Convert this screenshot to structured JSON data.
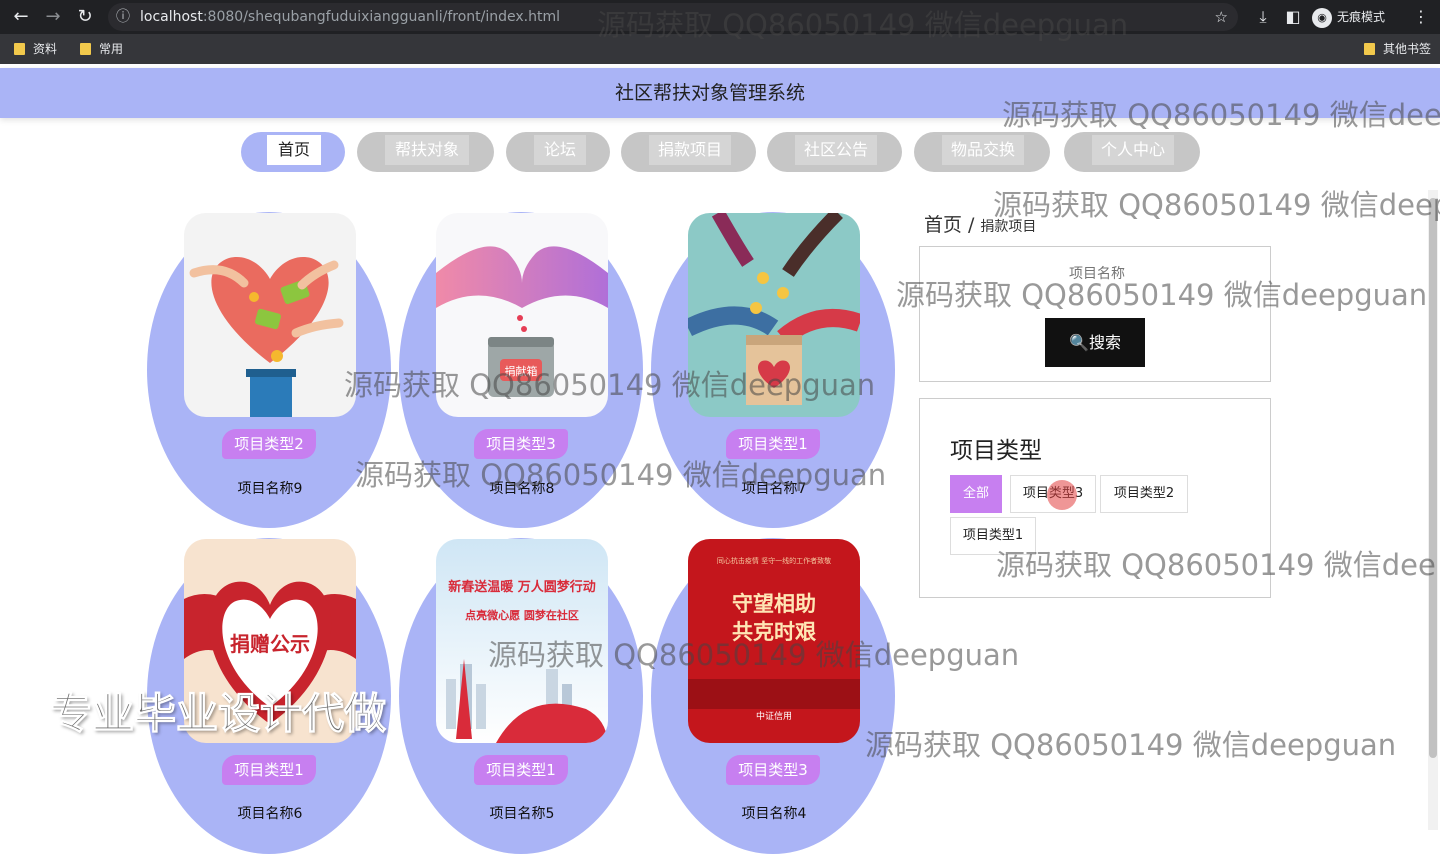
{
  "browser": {
    "url_host": "localhost",
    "url_path": ":8080/shequbangfuduixiangguanli/front/index.html",
    "incognito_label": "无痕模式",
    "bookmarks": [
      "资料",
      "常用"
    ],
    "other_bookmarks": "其他书签"
  },
  "site": {
    "title": "社区帮扶对象管理系统",
    "nav": [
      "首页",
      "帮扶对象",
      "论坛",
      "捐款项目",
      "社区公告",
      "物品交换",
      "个人中心"
    ]
  },
  "projects": [
    {
      "type": "项目类型2",
      "name": "项目名称9"
    },
    {
      "type": "项目类型3",
      "name": "项目名称8"
    },
    {
      "type": "项目类型1",
      "name": "项目名称7"
    },
    {
      "type": "项目类型1",
      "name": "项目名称6"
    },
    {
      "type": "项目类型1",
      "name": "项目名称5"
    },
    {
      "type": "项目类型3",
      "name": "项目名称4"
    }
  ],
  "image_texts": {
    "box_label": "捐献箱",
    "donation_notice": "捐赠公示",
    "poster_heading": "新春送温暖 万人圆梦行动",
    "poster_sub": "点亮微心愿 圆梦在社区",
    "red_poster_top": "同心抗击疫情 坚守一线的工作者致敬",
    "red_poster_line1": "守望相助",
    "red_poster_line2": "共克时艰",
    "red_poster_brand": "中证信用"
  },
  "sidebar": {
    "breadcrumb_home": "首页",
    "breadcrumb_sep": "/",
    "breadcrumb_current": "捐款项目",
    "search_placeholder": "项目名称",
    "search_button": "🔍搜索",
    "type_title": "项目类型",
    "type_options": [
      "全部",
      "项目类型3",
      "项目类型2",
      "项目类型1"
    ]
  },
  "watermarks": {
    "text_a": "源码获取 QQ86050149 微信deepguan",
    "text_b": "源码获取 QQ86050149 微信dee",
    "text_c": "源码获取 QQ86050149 微信deep",
    "big": "专业毕业设计代做"
  },
  "colors": {
    "accent_lavender": "#aab4f6",
    "tag_purple": "#c77ff0",
    "search_button": "#111111"
  }
}
